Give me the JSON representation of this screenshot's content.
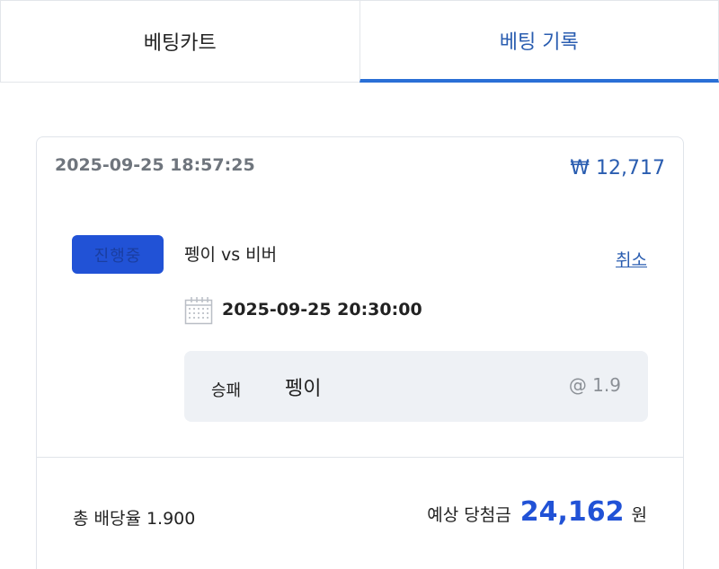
{
  "tabs": [
    {
      "label": "베팅카트",
      "active": false
    },
    {
      "label": "베팅 기록",
      "active": true
    }
  ],
  "bet": {
    "timestamp": "2025-09-25 18:57:25",
    "amount": "₩ 12,717",
    "status": "진행중",
    "match": "펭이 vs 비버",
    "cancel_label": "취소",
    "match_datetime": "2025-09-25 20:30:00",
    "pick": {
      "type": "승패",
      "selection": "펭이",
      "odds": "@ 1.9"
    },
    "total_odds_label": "총 배당율",
    "total_odds_value": "1.900",
    "expected_label": "예상 당첨금",
    "expected_value": "24,162",
    "expected_unit": "원"
  },
  "colors": {
    "accent": "#2a5db0",
    "badge": "#2152d6",
    "pick_bg": "#eef1f5"
  },
  "icons": {
    "calendar": "calendar-icon"
  }
}
